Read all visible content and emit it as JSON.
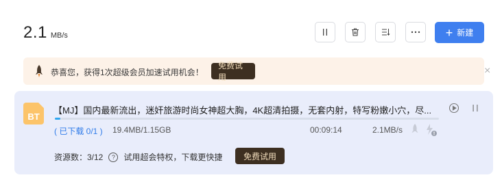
{
  "header": {
    "speed_value": "2.1",
    "speed_unit": "MB/s",
    "new_button_label": "新建"
  },
  "toolbar": {
    "icons": [
      "pause-icon",
      "trash-icon",
      "sort-icon",
      "more-icon",
      "plus-icon"
    ]
  },
  "promo": {
    "text": "恭喜您，获得1次超级会员加速试用机会！",
    "button_label": "免费试用",
    "close_glyph": "×"
  },
  "task": {
    "file_badge": "BT",
    "title": "【MJ】国内最新流出，迷奸旅游时尚女神超大胸，4K超清拍摄，无套内射，特写粉嫩小穴，尽...",
    "progress": 0.015,
    "downloaded_label": "( 已下载 0/1 )",
    "size_label": "19.4MB/1.15GB",
    "elapsed": "00:09:14",
    "rate": "2.1MB/s",
    "resource_count_label": "资源数：3/12",
    "privilege_text": "试用超会特权，下载更快捷",
    "trial_button_label": "免费试用"
  },
  "colors": {
    "accent": "#3f7fef",
    "promo_bg": "#fdf2e8",
    "card_bg": "#e9edfb",
    "trial_btn_bg": "#3d2f21",
    "trial_btn_text": "#f4dfbe",
    "progress": "#2ea7f0",
    "bt_badge": "#fcc46a"
  }
}
